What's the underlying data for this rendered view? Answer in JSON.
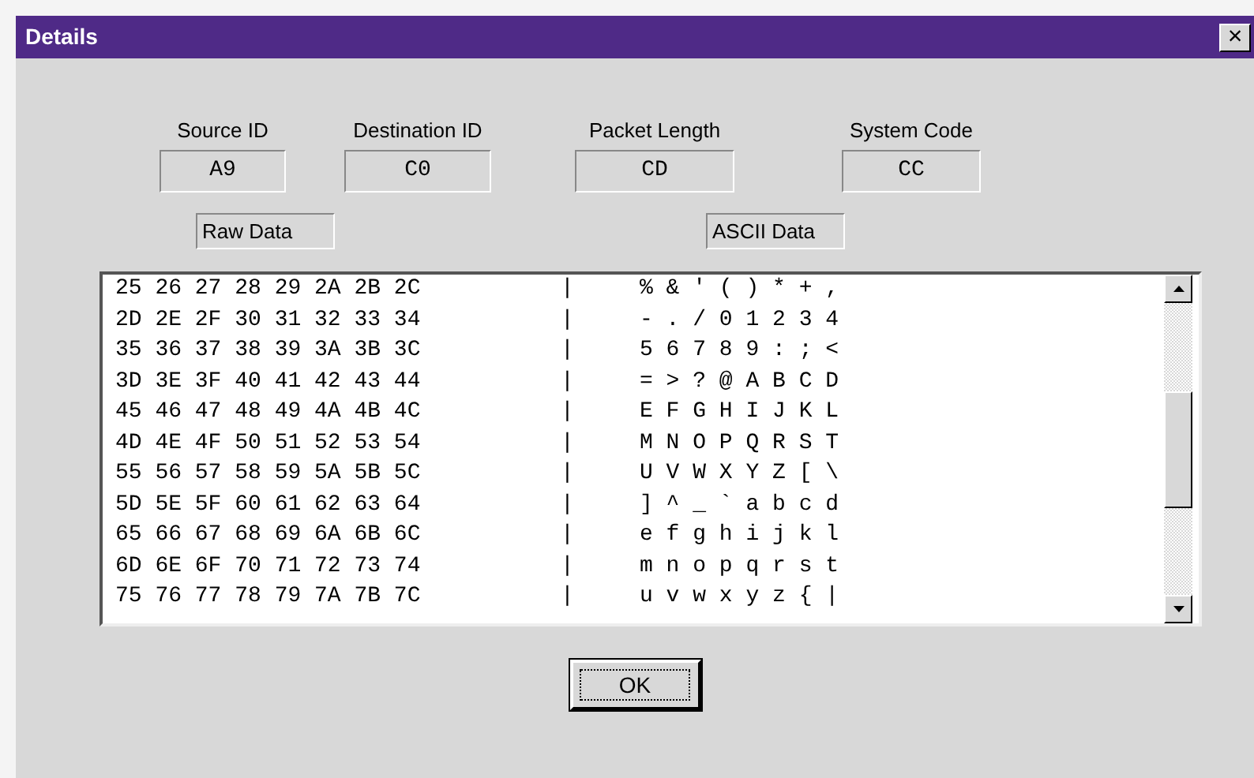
{
  "window": {
    "title": "Details",
    "close": "×"
  },
  "fields": [
    {
      "label": "Source ID",
      "value": "A9"
    },
    {
      "label": "Destination ID",
      "value": "C0"
    },
    {
      "label": "Packet Length",
      "value": "CD"
    },
    {
      "label": "System Code",
      "value": "CC"
    }
  ],
  "headers": [
    "Raw Data",
    "ASCII Data"
  ],
  "listing": [
    {
      "hex": "25 26 27 28 29 2A 2B 2C",
      "separator": "|",
      "ascii": "% & ' ( ) * + ,"
    },
    {
      "hex": "2D 2E 2F 30 31 32 33 34",
      "separator": "|",
      "ascii": "- . / 0 1 2 3 4"
    },
    {
      "hex": "35 36 37 38 39 3A 3B 3C",
      "separator": "|",
      "ascii": "5 6 7 8 9 : ; <"
    },
    {
      "hex": "3D 3E 3F 40 41 42 43 44",
      "separator": "|",
      "ascii": "= > ? @ A B C D"
    },
    {
      "hex": "45 46 47 48 49 4A 4B 4C",
      "separator": "|",
      "ascii": "E F G H I J K L"
    },
    {
      "hex": "4D 4E 4F 50 51 52 53 54",
      "separator": "|",
      "ascii": "M N O P Q R S T"
    },
    {
      "hex": "55 56 57 58 59 5A 5B 5C",
      "separator": "|",
      "ascii": "U V W X Y Z [ \\"
    },
    {
      "hex": "5D 5E 5F 60 61 62 63 64",
      "separator": "|",
      "ascii": "] ^ _ ` a b c d"
    },
    {
      "hex": "65 66 67 68 69 6A 6B 6C",
      "separator": "|",
      "ascii": "e f g h i j k l"
    },
    {
      "hex": "6D 6E 6F 70 71 72 73 74",
      "separator": "|",
      "ascii": "m n o p q r s t"
    },
    {
      "hex": "75 76 77 78 79 7A 7B 7C",
      "separator": "|",
      "ascii": "u v w x y z { |"
    }
  ],
  "buttons": [
    "OK"
  ]
}
